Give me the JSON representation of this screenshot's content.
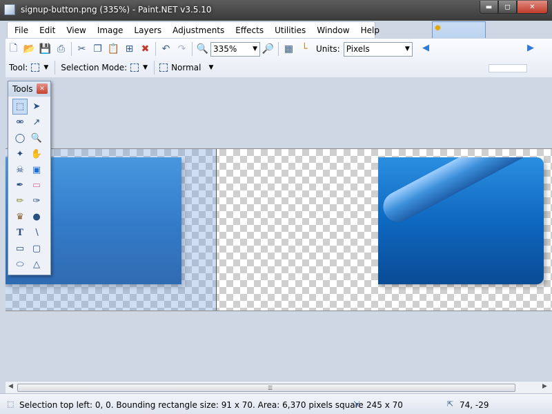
{
  "window": {
    "title": "signup-button.png (335%) - Paint.NET v3.5.10",
    "minimize_icon": "minimize-icon",
    "maximize_icon": "maximize-icon",
    "close_icon": "close-icon"
  },
  "menu": {
    "items": [
      "File",
      "Edit",
      "View",
      "Image",
      "Layers",
      "Adjustments",
      "Effects",
      "Utilities",
      "Window",
      "Help"
    ]
  },
  "toolbar": {
    "zoom_value": "335%",
    "units_label": "Units:",
    "units_value": "Pixels",
    "tool_label": "Tool:",
    "selection_mode_label": "Selection Mode:",
    "blend_mode": "Normal"
  },
  "tools_window": {
    "title": "Tools",
    "active_tool": "rectangle-select"
  },
  "statusbar": {
    "selection_info": "Selection top left: 0, 0. Bounding rectangle size: 91 x 70. Area: 6,370 pixels square",
    "image_size": "245 x 70",
    "cursor_position": "74, -29"
  },
  "colors": {
    "title_bar": "#3a3a3a",
    "accent": "#2f7ad6",
    "button_blue": "#0f6ac0"
  }
}
